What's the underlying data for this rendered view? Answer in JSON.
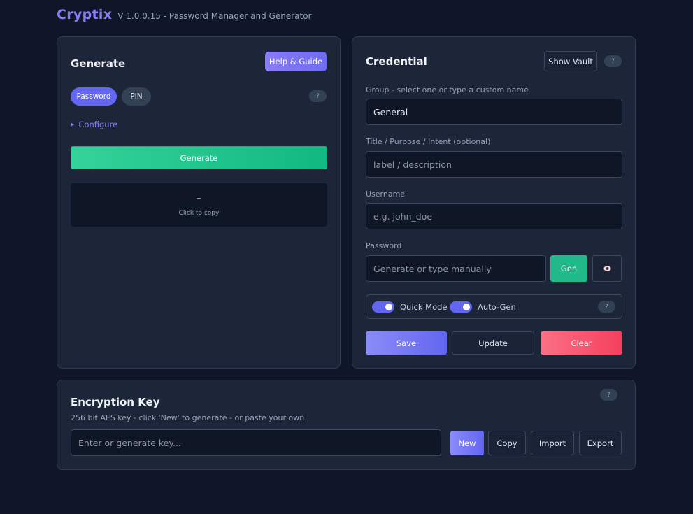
{
  "app": {
    "name": "Cryptix",
    "subtitle": "V 1.0.0.15 - Password Manager and Generator"
  },
  "generate": {
    "title": "Generate",
    "help_label": "Help & Guide",
    "tabs": [
      {
        "label": "Password",
        "active": true
      },
      {
        "label": "PIN",
        "active": false
      }
    ],
    "info_label": "?",
    "configure_label": "Configure",
    "generate_label": "Generate",
    "output_value": "_",
    "output_hint": "Click to copy"
  },
  "credential": {
    "title": "Credential",
    "show_vault_label": "Show Vault",
    "info_label": "?",
    "group": {
      "label": "Group - select one or type a custom name",
      "value": "General"
    },
    "title_field": {
      "label": "Title / Purpose / Intent (optional)",
      "placeholder": "label / description"
    },
    "username": {
      "label": "Username",
      "placeholder": "e.g. john_doe"
    },
    "password": {
      "label": "Password",
      "placeholder": "Generate or type manually",
      "gen_label": "Gen"
    },
    "toggles": [
      {
        "label": "Quick Mode",
        "on": true
      },
      {
        "label": "Auto-Gen",
        "on": true
      }
    ],
    "toggles_info": "?",
    "save_label": "Save",
    "update_label": "Update",
    "clear_label": "Clear"
  },
  "encryption": {
    "title": "Encryption Key",
    "info_label": "?",
    "description": "256 bit AES key - click 'New' to generate - or paste your own",
    "placeholder": "Enter or generate key...",
    "new_label": "New",
    "copy_label": "Copy",
    "import_label": "Import",
    "export_label": "Export"
  },
  "colors": {
    "background": "#0f1627",
    "panel": "#1c2638",
    "accent": "#6366f1",
    "success": "#10b981",
    "danger": "#f43f5e"
  }
}
